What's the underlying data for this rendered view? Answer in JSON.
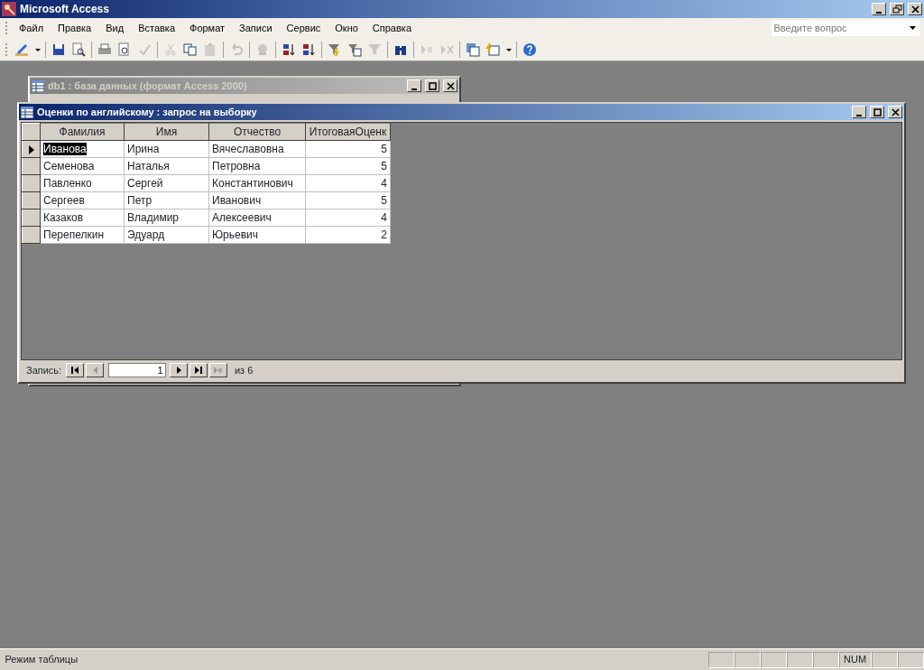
{
  "app": {
    "title": "Microsoft Access",
    "help_box": {
      "placeholder": "Введите вопрос"
    }
  },
  "menu": [
    "Файл",
    "Правка",
    "Вид",
    "Вставка",
    "Формат",
    "Записи",
    "Сервис",
    "Окно",
    "Справка"
  ],
  "toolbar": [
    {
      "kind": "design",
      "disabled": false
    },
    {
      "kind": "dropdown",
      "disabled": false
    },
    {
      "kind": "sep"
    },
    {
      "kind": "save",
      "disabled": false
    },
    {
      "kind": "search-file",
      "disabled": false
    },
    {
      "kind": "sep"
    },
    {
      "kind": "print",
      "disabled": false
    },
    {
      "kind": "preview",
      "disabled": false
    },
    {
      "kind": "spell",
      "disabled": true
    },
    {
      "kind": "sep"
    },
    {
      "kind": "cut",
      "disabled": true
    },
    {
      "kind": "copy",
      "disabled": false
    },
    {
      "kind": "paste",
      "disabled": true
    },
    {
      "kind": "sep"
    },
    {
      "kind": "undo",
      "disabled": true
    },
    {
      "kind": "sep"
    },
    {
      "kind": "link",
      "disabled": true
    },
    {
      "kind": "sep"
    },
    {
      "kind": "sort-asc",
      "disabled": false
    },
    {
      "kind": "sort-desc",
      "disabled": false
    },
    {
      "kind": "sep"
    },
    {
      "kind": "filter-sel",
      "disabled": false
    },
    {
      "kind": "filter-form",
      "disabled": false
    },
    {
      "kind": "filter",
      "disabled": true
    },
    {
      "kind": "sep"
    },
    {
      "kind": "find",
      "disabled": false
    },
    {
      "kind": "sep"
    },
    {
      "kind": "new-rec",
      "disabled": true
    },
    {
      "kind": "delete-rec",
      "disabled": true
    },
    {
      "kind": "sep"
    },
    {
      "kind": "db-window",
      "disabled": false
    },
    {
      "kind": "new-object",
      "disabled": false
    },
    {
      "kind": "dropdown",
      "disabled": false
    },
    {
      "kind": "sep"
    },
    {
      "kind": "help",
      "disabled": false
    }
  ],
  "db_window": {
    "title": "db1 : база данных (формат Access 2000)",
    "active": false
  },
  "query_window": {
    "title": "Оценки по английскому : запрос на выборку",
    "active": true,
    "columns": [
      "Фамилия",
      "Имя",
      "Отчество",
      "ИтоговаяОценк"
    ],
    "rows": [
      {
        "selected": true,
        "cells": [
          "Иванова",
          "Ирина",
          "Вячеславовна",
          "5"
        ]
      },
      {
        "selected": false,
        "cells": [
          "Семенова",
          "Наталья",
          "Петровна",
          "5"
        ]
      },
      {
        "selected": false,
        "cells": [
          "Павленко",
          "Сергей",
          "Константинович",
          "4"
        ]
      },
      {
        "selected": false,
        "cells": [
          "Сергеев",
          "Петр",
          "Иванович",
          "5"
        ]
      },
      {
        "selected": false,
        "cells": [
          "Казаков",
          "Владимир",
          "Алексеевич",
          "4"
        ]
      },
      {
        "selected": false,
        "cells": [
          "Перепелкин",
          "Эдуард",
          "Юрьевич",
          "2"
        ]
      }
    ],
    "navigator": {
      "label": "Запись:",
      "current": "1",
      "total": "из 6",
      "buttons": [
        {
          "kind": "first",
          "disabled": false
        },
        {
          "kind": "prev",
          "disabled": true
        },
        {
          "kind": "field"
        },
        {
          "kind": "next",
          "disabled": false
        },
        {
          "kind": "last",
          "disabled": false
        },
        {
          "kind": "new",
          "disabled": true
        }
      ]
    }
  },
  "status_bar": {
    "text": "Режим таблицы",
    "indicators": [
      {
        "kind": "empty"
      },
      {
        "kind": "empty"
      },
      {
        "kind": "empty"
      },
      {
        "kind": "empty"
      },
      {
        "kind": "empty"
      },
      {
        "kind": "text",
        "text": "NUM"
      },
      {
        "kind": "empty"
      },
      {
        "kind": "empty"
      }
    ]
  }
}
